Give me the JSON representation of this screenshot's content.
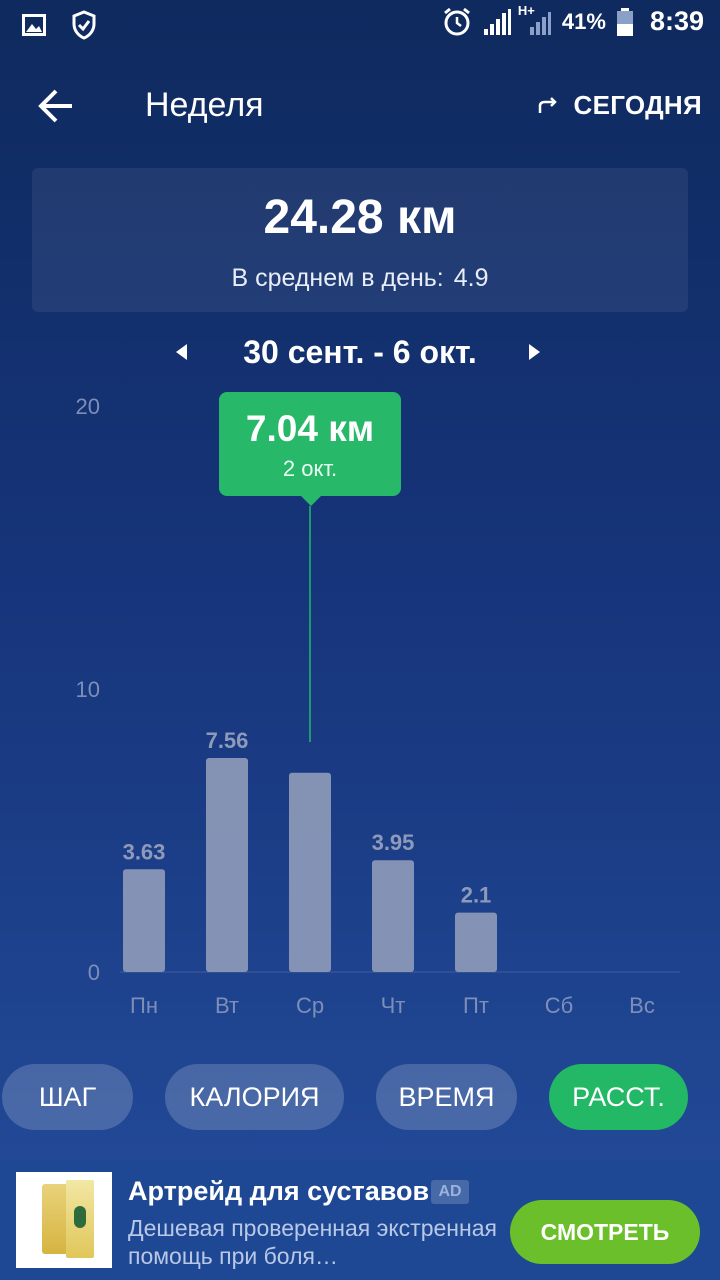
{
  "status_bar": {
    "battery": "41%",
    "network": "H+",
    "time": "8:39"
  },
  "toolbar": {
    "title": "Неделя",
    "today_label": "СЕГОДНЯ"
  },
  "summary": {
    "total": "24.28 км",
    "average_label": "В среднем в день:",
    "average_value": "4.9"
  },
  "range": {
    "label": "30 сент. - 6 окт."
  },
  "tooltip": {
    "value": "7.04 км",
    "date": "2 окт."
  },
  "metrics": [
    {
      "label": "ШАГ",
      "active": false
    },
    {
      "label": "КАЛОРИЯ",
      "active": false
    },
    {
      "label": "ВРЕМЯ",
      "active": false
    },
    {
      "label": "РАССТ.",
      "active": true
    }
  ],
  "ad": {
    "title": "Артрейд для суставов",
    "badge": "AD",
    "description": "Дешевая проверенная экстренная помощь при боля…",
    "cta": "СМОТРЕТЬ"
  },
  "colors": {
    "accent_green": "#27b86a",
    "bar": "#8d9ab9",
    "axis_label": "#7d8fb8"
  },
  "chart_data": {
    "type": "bar",
    "categories": [
      "Пн",
      "Вт",
      "Ср",
      "Чт",
      "Пт",
      "Сб",
      "Вс"
    ],
    "values": [
      3.63,
      7.56,
      7.04,
      3.95,
      2.1,
      null,
      null
    ],
    "value_labels": [
      "3.63",
      "7.56",
      "",
      "3.95",
      "2.1",
      "",
      ""
    ],
    "selected_index": 2,
    "y_ticks": [
      "0",
      "10",
      "20"
    ],
    "ylim": [
      0,
      20
    ],
    "grid": false
  }
}
